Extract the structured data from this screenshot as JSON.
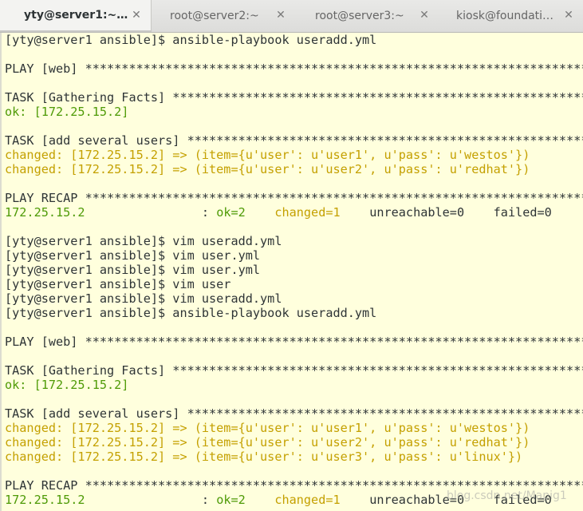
{
  "tabs": [
    {
      "label": "yty@server1:~…",
      "active": true
    },
    {
      "label": "root@server2:~",
      "active": false
    },
    {
      "label": "root@server3:~",
      "active": false
    },
    {
      "label": "kiosk@foundati…",
      "active": false
    }
  ],
  "close_glyph": "✕",
  "watermark": "blog.csdn.net/Mapig1",
  "terminal": {
    "background": "#ffffdd",
    "text_color": "#2e3436",
    "ok_color": "#4e9a06",
    "changed_color": "#c4a000",
    "lines": [
      {
        "kind": "plain",
        "text": "[yty@server1 ansible]$ ansible-playbook useradd.yml"
      },
      {
        "kind": "plain",
        "text": ""
      },
      {
        "kind": "plain",
        "text": "PLAY [web] *****************************************************************************"
      },
      {
        "kind": "plain",
        "text": ""
      },
      {
        "kind": "plain",
        "text": "TASK [Gathering Facts] *****************************************************************"
      },
      {
        "kind": "ok",
        "text": "ok: [172.25.15.2]"
      },
      {
        "kind": "plain",
        "text": ""
      },
      {
        "kind": "plain",
        "text": "TASK [add several users] ***************************************************************"
      },
      {
        "kind": "changed",
        "text": "changed: [172.25.15.2] => (item={u'user': u'user1', u'pass': u'westos'})"
      },
      {
        "kind": "changed",
        "text": "changed: [172.25.15.2] => (item={u'user': u'user2', u'pass': u'redhat'})"
      },
      {
        "kind": "plain",
        "text": ""
      },
      {
        "kind": "plain",
        "text": "PLAY RECAP *****************************************************************************"
      },
      {
        "kind": "recap",
        "host": "172.25.15.2",
        "pad1": "                : ",
        "ok": "ok=2",
        "pad2": "    ",
        "changed": "changed=1",
        "pad3": "    ",
        "rest": "unreachable=0    failed=0"
      },
      {
        "kind": "plain",
        "text": ""
      },
      {
        "kind": "plain",
        "text": "[yty@server1 ansible]$ vim useradd.yml"
      },
      {
        "kind": "plain",
        "text": "[yty@server1 ansible]$ vim user.yml"
      },
      {
        "kind": "plain",
        "text": "[yty@server1 ansible]$ vim user.yml"
      },
      {
        "kind": "plain",
        "text": "[yty@server1 ansible]$ vim user"
      },
      {
        "kind": "plain",
        "text": "[yty@server1 ansible]$ vim useradd.yml"
      },
      {
        "kind": "plain",
        "text": "[yty@server1 ansible]$ ansible-playbook useradd.yml"
      },
      {
        "kind": "plain",
        "text": ""
      },
      {
        "kind": "plain",
        "text": "PLAY [web] *****************************************************************************"
      },
      {
        "kind": "plain",
        "text": ""
      },
      {
        "kind": "plain",
        "text": "TASK [Gathering Facts] *****************************************************************"
      },
      {
        "kind": "ok",
        "text": "ok: [172.25.15.2]"
      },
      {
        "kind": "plain",
        "text": ""
      },
      {
        "kind": "plain",
        "text": "TASK [add several users] ***************************************************************"
      },
      {
        "kind": "changed",
        "text": "changed: [172.25.15.2] => (item={u'user': u'user1', u'pass': u'westos'})"
      },
      {
        "kind": "changed",
        "text": "changed: [172.25.15.2] => (item={u'user': u'user2', u'pass': u'redhat'})"
      },
      {
        "kind": "changed",
        "text": "changed: [172.25.15.2] => (item={u'user': u'user3', u'pass': u'linux'})"
      },
      {
        "kind": "plain",
        "text": ""
      },
      {
        "kind": "plain",
        "text": "PLAY RECAP *****************************************************************************"
      },
      {
        "kind": "recap",
        "host": "172.25.15.2",
        "pad1": "                : ",
        "ok": "ok=2",
        "pad2": "    ",
        "changed": "changed=1",
        "pad3": "    ",
        "rest": "unreachable=0    failed=0"
      }
    ]
  }
}
